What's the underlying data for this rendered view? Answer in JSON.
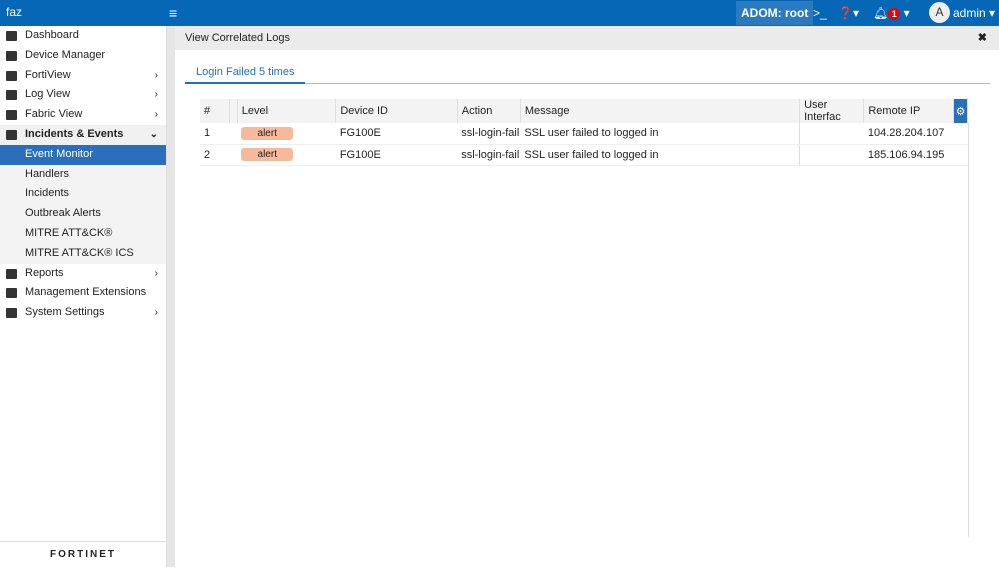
{
  "header": {
    "logo": "faz",
    "adom": "ADOM: root",
    "notifications": "1",
    "user_initial": "A",
    "user": "admin"
  },
  "sidebar": {
    "items": [
      {
        "label": "Dashboard",
        "icon": "dashboard-icon"
      },
      {
        "label": "Device Manager",
        "icon": "device-icon"
      },
      {
        "label": "FortiView",
        "icon": "fortiview-icon",
        "chevron": "›"
      },
      {
        "label": "Log View",
        "icon": "log-icon",
        "chevron": "›"
      },
      {
        "label": "Fabric View",
        "icon": "fabric-icon",
        "chevron": "›"
      },
      {
        "label": "Incidents & Events",
        "icon": "incidents-icon",
        "chevron": "⌄"
      },
      {
        "label": "Event Monitor"
      },
      {
        "label": "Handlers"
      },
      {
        "label": "Incidents"
      },
      {
        "label": "Outbreak Alerts"
      },
      {
        "label": "MITRE ATT&CK®"
      },
      {
        "label": "MITRE ATT&CK® ICS"
      },
      {
        "label": "Reports",
        "icon": "reports-icon",
        "chevron": "›"
      },
      {
        "label": "Management Extensions",
        "icon": "extensions-icon"
      },
      {
        "label": "System Settings",
        "icon": "gear-icon",
        "chevron": "›"
      }
    ],
    "footer": "FORTINET"
  },
  "main": {
    "title": "View Correlated Logs",
    "tab": "Login Failed 5 times",
    "columns": [
      "#",
      "",
      "Level",
      "Device ID",
      "Action",
      "Message",
      "User Interfac",
      "Remote IP"
    ],
    "rows": [
      [
        "1",
        "",
        "alert",
        "FG100E",
        "ssl-login-fail",
        "SSL user failed to logged in",
        "",
        "104.28.204.107"
      ],
      [
        "2",
        "",
        "alert",
        "FG100E",
        "ssl-login-fail",
        "SSL user failed to logged in",
        "",
        "185.106.94.195"
      ]
    ]
  }
}
